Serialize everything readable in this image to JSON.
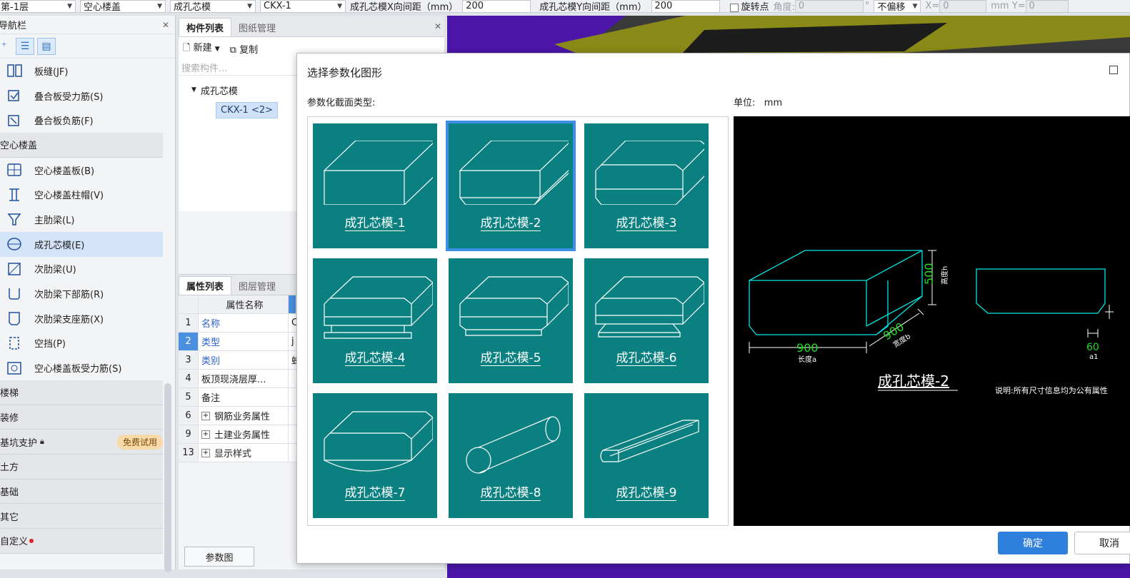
{
  "toolbar": {
    "floor": "第-1层",
    "category": "空心楼盖",
    "type": "成孔芯模",
    "component": "CKX-1",
    "x_spacing_label": "成孔芯模X向间距（mm）",
    "x_spacing_value": "200",
    "y_spacing_label": "成孔芯模Y向间距（mm）",
    "y_spacing_value": "200",
    "rotate_label": "旋转点",
    "angle_label": "角度:",
    "angle_value": "0",
    "degree": "°",
    "offset": "不偏移",
    "x_label": "X=",
    "x_value": "0",
    "mm_y_label": "mm Y=",
    "y_value": "0"
  },
  "nav": {
    "title": "导航栏",
    "items": [
      {
        "label": "板缝(JF)"
      },
      {
        "label": "叠合板受力筋(S)"
      },
      {
        "label": "叠合板负筋(F)"
      }
    ],
    "cat_hollow": "空心楼盖",
    "hollow_items": [
      {
        "label": "空心楼盖板(B)"
      },
      {
        "label": "空心楼盖柱帽(V)"
      },
      {
        "label": "主肋梁(L)"
      },
      {
        "label": "成孔芯模(E)"
      },
      {
        "label": "次肋梁(U)"
      },
      {
        "label": "次肋梁下部筋(R)"
      },
      {
        "label": "次肋梁支座筋(X)"
      },
      {
        "label": "空挡(P)"
      },
      {
        "label": "空心楼盖板受力筋(S)"
      }
    ],
    "cats": [
      "楼梯",
      "装修",
      "基坑支护",
      "土方",
      "基础",
      "其它",
      "自定义"
    ],
    "trial_badge": "免费试用"
  },
  "mid": {
    "tab_list": "构件列表",
    "tab_drawing": "图纸管理",
    "new_label": "新建",
    "copy_label": "复制",
    "search_placeholder": "搜索构件...",
    "tree_root": "成孔芯模",
    "tree_child": "CKX-1 <2>",
    "tab_props": "属性列表",
    "tab_layers": "图层管理",
    "prop_header": "属性名称",
    "props": [
      {
        "no": "1",
        "name": "名称",
        "value": "C"
      },
      {
        "no": "2",
        "name": "类型",
        "value": "j"
      },
      {
        "no": "3",
        "name": "类别",
        "value": "蜂"
      },
      {
        "no": "4",
        "name": "板顶现浇层厚...",
        "value": ""
      },
      {
        "no": "5",
        "name": "备注",
        "value": ""
      },
      {
        "no": "6",
        "name": "钢筋业务属性",
        "value": ""
      },
      {
        "no": "9",
        "name": "土建业务属性",
        "value": ""
      },
      {
        "no": "13",
        "name": "显示样式",
        "value": ""
      }
    ],
    "param_button": "参数图"
  },
  "dialog": {
    "title": "选择参数化图形",
    "section_label": "参数化截面类型:",
    "unit_label": "单位:",
    "unit_value": "mm",
    "shapes": [
      "成孔芯模-1",
      "成孔芯模-2",
      "成孔芯模-3",
      "成孔芯模-4",
      "成孔芯模-5",
      "成孔芯模-6",
      "成孔芯模-7",
      "成孔芯模-8",
      "成孔芯模-9"
    ],
    "selected_index": 1,
    "preview": {
      "dim_height": "500",
      "dim_height_label": "高度h",
      "dim_width": "900",
      "dim_width_label": "宽度b",
      "dim_length": "900",
      "dim_length_label": "长度a",
      "dim_chamfer": "60",
      "dim_chamfer_label": "a1",
      "title": "成孔芯模-2",
      "note": "说明:所有尺寸信息均为公有属性"
    },
    "ok": "确定",
    "cancel": "取消"
  },
  "colors": {
    "accent": "#2f7fdc",
    "tile": "#0b8080",
    "preview_line": "#00e5e5",
    "dim_green": "#22dd22"
  }
}
